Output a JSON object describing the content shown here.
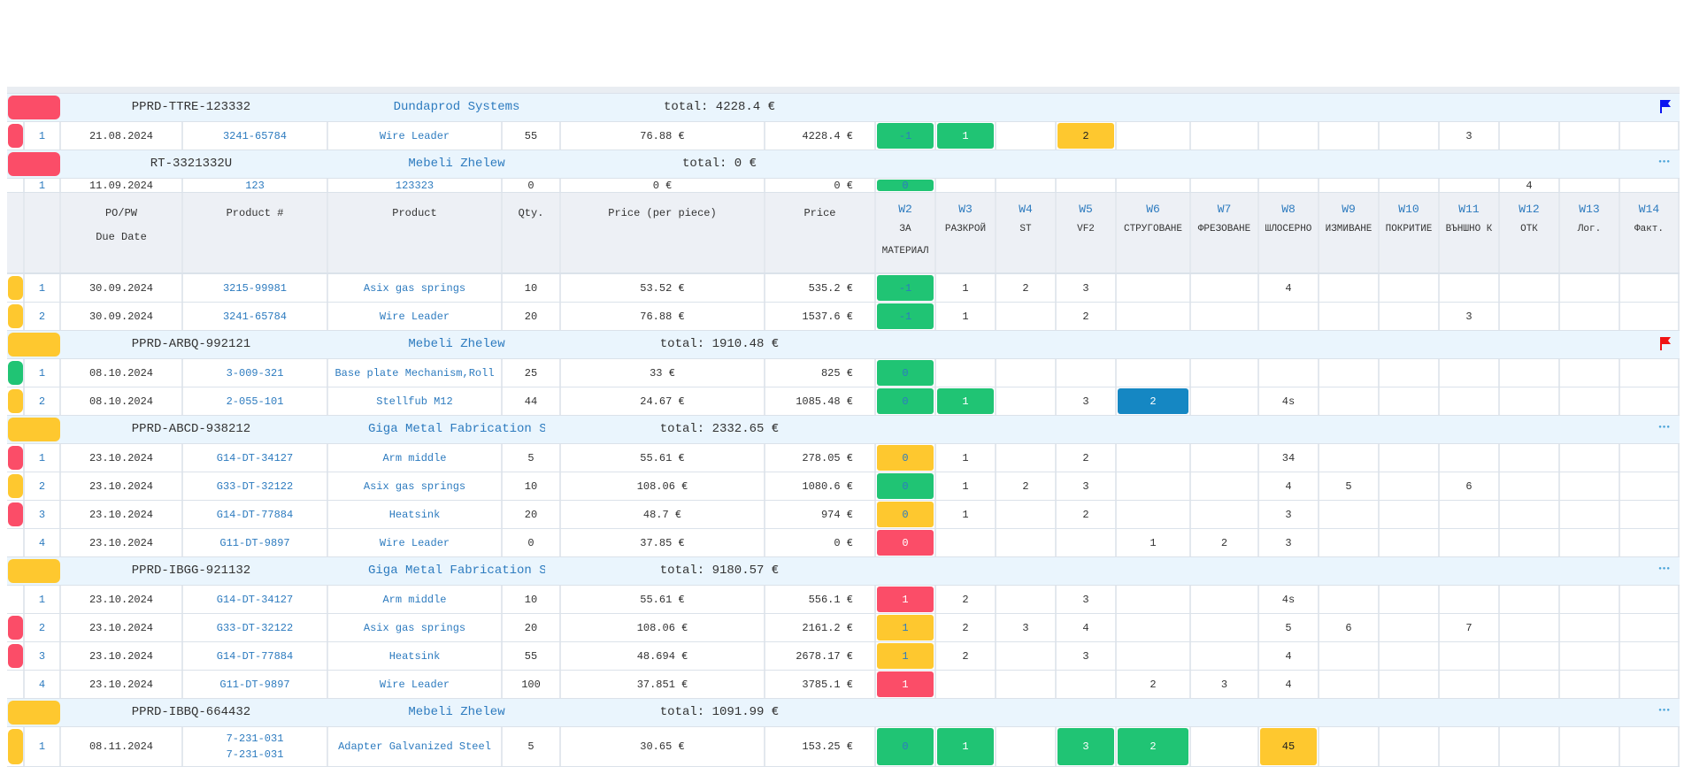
{
  "header": {
    "col_po": "PO/PW",
    "col_due": "Due Date",
    "col_product_no": "Product #",
    "col_product": "Product",
    "col_qty": "Qty.",
    "col_price_piece": "Price (per piece)",
    "col_price": "Price",
    "workstations": [
      {
        "code": "W2",
        "name": "ЗА",
        "name2": "МАТЕРИАЛ"
      },
      {
        "code": "W3",
        "name": "РАЗКРОЙ"
      },
      {
        "code": "W4",
        "name": "ST"
      },
      {
        "code": "W5",
        "name": "VF2"
      },
      {
        "code": "W6",
        "name": "СТРУГОВАНЕ"
      },
      {
        "code": "W7",
        "name": "ФРЕЗОВАНЕ"
      },
      {
        "code": "W8",
        "name": "ШЛОСЕРНО"
      },
      {
        "code": "W9",
        "name": "ИЗМИВАНЕ"
      },
      {
        "code": "W10",
        "name": "ПОКРИТИЕ"
      },
      {
        "code": "W11",
        "name": "ВЪНШНО К"
      },
      {
        "code": "W12",
        "name": "ОТК"
      },
      {
        "code": "W13",
        "name": "Лог."
      },
      {
        "code": "W14",
        "name": "Факт."
      }
    ]
  },
  "colors": {
    "green": "#20c474",
    "yellow": "#fec82f",
    "red": "#fb4d68",
    "blue": "#1587c3",
    "link": "#2d7bbf",
    "group_bg": "#eaf5fd"
  },
  "groups": [
    {
      "po": "PPRD-TTRE-123332",
      "client": "Dundaprod Systems",
      "total": "total: 4228.4 €",
      "status": "red",
      "icon": "flag-blue",
      "items": [
        {
          "n": "1",
          "date": "21.08.2024",
          "pn": "3241-65784",
          "product": "Wire Leader",
          "qty": "55",
          "ppp": "76.88 €",
          "price": "4228.4 €",
          "status": "red",
          "w": [
            {
              "v": "-1",
              "c": "green",
              "blue": true
            },
            {
              "v": "1",
              "c": "green"
            },
            {
              "v": ""
            },
            {
              "v": "2",
              "c": "yellow"
            },
            {
              "v": ""
            },
            {
              "v": ""
            },
            {
              "v": ""
            },
            {
              "v": ""
            },
            {
              "v": ""
            },
            {
              "v": "3"
            },
            {
              "v": ""
            },
            {
              "v": ""
            },
            {
              "v": ""
            }
          ]
        }
      ]
    },
    {
      "po": "RT-3321332U",
      "client": "Mebeli Zhelew",
      "total": "total: 0 €",
      "status": "red",
      "icon": "dots",
      "items": [
        {
          "n": "1",
          "date": "11.09.2024",
          "pn": "123",
          "product": "123323",
          "qty": "0",
          "ppp": "0 €",
          "price": "0 €",
          "status": "",
          "w": [
            {
              "v": "0",
              "c": "green",
              "blue": true
            },
            {
              "v": ""
            },
            {
              "v": ""
            },
            {
              "v": ""
            },
            {
              "v": ""
            },
            {
              "v": ""
            },
            {
              "v": ""
            },
            {
              "v": ""
            },
            {
              "v": ""
            },
            {
              "v": ""
            },
            {
              "v": "4"
            },
            {
              "v": ""
            },
            {
              "v": ""
            }
          ]
        },
        {
          "n": "1",
          "date": "30.09.2024",
          "pn": "3215-99981",
          "product": "Asix gas springs",
          "qty": "10",
          "ppp": "53.52 €",
          "price": "535.2 €",
          "status": "yellow",
          "w": [
            {
              "v": "-1",
              "c": "green",
              "blue": true
            },
            {
              "v": "1"
            },
            {
              "v": "2"
            },
            {
              "v": "3"
            },
            {
              "v": ""
            },
            {
              "v": ""
            },
            {
              "v": "4"
            },
            {
              "v": ""
            },
            {
              "v": ""
            },
            {
              "v": ""
            },
            {
              "v": ""
            },
            {
              "v": ""
            },
            {
              "v": ""
            }
          ]
        },
        {
          "n": "2",
          "date": "30.09.2024",
          "pn": "3241-65784",
          "product": "Wire Leader",
          "qty": "20",
          "ppp": "76.88 €",
          "price": "1537.6 €",
          "status": "yellow",
          "w": [
            {
              "v": "-1",
              "c": "green",
              "blue": true
            },
            {
              "v": "1"
            },
            {
              "v": ""
            },
            {
              "v": "2"
            },
            {
              "v": ""
            },
            {
              "v": ""
            },
            {
              "v": ""
            },
            {
              "v": ""
            },
            {
              "v": ""
            },
            {
              "v": "3"
            },
            {
              "v": ""
            },
            {
              "v": ""
            },
            {
              "v": ""
            }
          ]
        }
      ]
    },
    {
      "po": "PPRD-ARBQ-992121",
      "client": "Mebeli Zhelew",
      "total": "total: 1910.48 €",
      "status": "yellow",
      "icon": "flag-red",
      "items": [
        {
          "n": "1",
          "date": "08.10.2024",
          "pn": "3-009-321",
          "product": "Base plate Mechanism,Roll",
          "qty": "25",
          "ppp": "33 €",
          "price": "825 €",
          "status": "green",
          "w": [
            {
              "v": "0",
              "c": "green",
              "blue": true
            },
            {
              "v": ""
            },
            {
              "v": ""
            },
            {
              "v": ""
            },
            {
              "v": ""
            },
            {
              "v": ""
            },
            {
              "v": ""
            },
            {
              "v": ""
            },
            {
              "v": ""
            },
            {
              "v": ""
            },
            {
              "v": ""
            },
            {
              "v": ""
            },
            {
              "v": ""
            }
          ]
        },
        {
          "n": "2",
          "date": "08.10.2024",
          "pn": "2-055-101",
          "product": "Stellfub M12",
          "qty": "44",
          "ppp": "24.67 €",
          "price": "1085.48 €",
          "status": "yellow",
          "w": [
            {
              "v": "0",
              "c": "green",
              "blue": true
            },
            {
              "v": "1",
              "c": "green"
            },
            {
              "v": ""
            },
            {
              "v": "3"
            },
            {
              "v": "2",
              "c": "blue"
            },
            {
              "v": ""
            },
            {
              "v": "4s"
            },
            {
              "v": ""
            },
            {
              "v": ""
            },
            {
              "v": ""
            },
            {
              "v": ""
            },
            {
              "v": ""
            },
            {
              "v": ""
            }
          ]
        }
      ]
    },
    {
      "po": "PPRD-ABCD-938212",
      "client": "Giga Metal Fabrication Systems",
      "total": "total: 2332.65 €",
      "status": "yellow",
      "icon": "dots",
      "items": [
        {
          "n": "1",
          "date": "23.10.2024",
          "pn": "G14-DT-34127",
          "product": "Arm middle",
          "qty": "5",
          "ppp": "55.61 €",
          "price": "278.05 €",
          "status": "red",
          "w": [
            {
              "v": "0",
              "c": "yellow",
              "blue": true
            },
            {
              "v": "1"
            },
            {
              "v": ""
            },
            {
              "v": "2"
            },
            {
              "v": ""
            },
            {
              "v": ""
            },
            {
              "v": "34"
            },
            {
              "v": ""
            },
            {
              "v": ""
            },
            {
              "v": ""
            },
            {
              "v": ""
            },
            {
              "v": ""
            },
            {
              "v": ""
            }
          ]
        },
        {
          "n": "2",
          "date": "23.10.2024",
          "pn": "G33-DT-32122",
          "product": "Asix gas springs",
          "qty": "10",
          "ppp": "108.06 €",
          "price": "1080.6 €",
          "status": "yellow",
          "w": [
            {
              "v": "0",
              "c": "green",
              "blue": true
            },
            {
              "v": "1"
            },
            {
              "v": "2"
            },
            {
              "v": "3"
            },
            {
              "v": ""
            },
            {
              "v": ""
            },
            {
              "v": "4"
            },
            {
              "v": "5"
            },
            {
              "v": ""
            },
            {
              "v": "6"
            },
            {
              "v": ""
            },
            {
              "v": ""
            },
            {
              "v": ""
            }
          ]
        },
        {
          "n": "3",
          "date": "23.10.2024",
          "pn": "G14-DT-77884",
          "product": "Heatsink",
          "qty": "20",
          "ppp": "48.7 €",
          "price": "974 €",
          "status": "red",
          "w": [
            {
              "v": "0",
              "c": "yellow",
              "blue": true
            },
            {
              "v": "1"
            },
            {
              "v": ""
            },
            {
              "v": "2"
            },
            {
              "v": ""
            },
            {
              "v": ""
            },
            {
              "v": "3"
            },
            {
              "v": ""
            },
            {
              "v": ""
            },
            {
              "v": ""
            },
            {
              "v": ""
            },
            {
              "v": ""
            },
            {
              "v": ""
            }
          ]
        },
        {
          "n": "4",
          "date": "23.10.2024",
          "pn": "G11-DT-9897",
          "product": "Wire Leader",
          "qty": "0",
          "ppp": "37.85 €",
          "price": "0 €",
          "status": "",
          "w": [
            {
              "v": "0",
              "c": "red"
            },
            {
              "v": ""
            },
            {
              "v": ""
            },
            {
              "v": ""
            },
            {
              "v": "1"
            },
            {
              "v": "2"
            },
            {
              "v": "3"
            },
            {
              "v": ""
            },
            {
              "v": ""
            },
            {
              "v": ""
            },
            {
              "v": ""
            },
            {
              "v": ""
            },
            {
              "v": ""
            }
          ]
        }
      ]
    },
    {
      "po": "PPRD-IBGG-921132",
      "client": "Giga Metal Fabrication Systems",
      "total": "total: 9180.57 €",
      "status": "yellow",
      "icon": "dots",
      "items": [
        {
          "n": "1",
          "date": "23.10.2024",
          "pn": "G14-DT-34127",
          "product": "Arm middle",
          "qty": "10",
          "ppp": "55.61 €",
          "price": "556.1 €",
          "status": "",
          "w": [
            {
              "v": "1",
              "c": "red"
            },
            {
              "v": "2"
            },
            {
              "v": ""
            },
            {
              "v": "3"
            },
            {
              "v": ""
            },
            {
              "v": ""
            },
            {
              "v": "4s"
            },
            {
              "v": ""
            },
            {
              "v": ""
            },
            {
              "v": ""
            },
            {
              "v": ""
            },
            {
              "v": ""
            },
            {
              "v": ""
            }
          ]
        },
        {
          "n": "2",
          "date": "23.10.2024",
          "pn": "G33-DT-32122",
          "product": "Asix gas springs",
          "qty": "20",
          "ppp": "108.06 €",
          "price": "2161.2 €",
          "status": "red",
          "w": [
            {
              "v": "1",
              "c": "yellow",
              "blue": true
            },
            {
              "v": "2"
            },
            {
              "v": "3"
            },
            {
              "v": "4"
            },
            {
              "v": ""
            },
            {
              "v": ""
            },
            {
              "v": "5"
            },
            {
              "v": "6"
            },
            {
              "v": ""
            },
            {
              "v": "7"
            },
            {
              "v": ""
            },
            {
              "v": ""
            },
            {
              "v": ""
            }
          ]
        },
        {
          "n": "3",
          "date": "23.10.2024",
          "pn": "G14-DT-77884",
          "product": "Heatsink",
          "qty": "55",
          "ppp": "48.694 €",
          "price": "2678.17 €",
          "status": "red",
          "w": [
            {
              "v": "1",
              "c": "yellow",
              "blue": true
            },
            {
              "v": "2"
            },
            {
              "v": ""
            },
            {
              "v": "3"
            },
            {
              "v": ""
            },
            {
              "v": ""
            },
            {
              "v": "4"
            },
            {
              "v": ""
            },
            {
              "v": ""
            },
            {
              "v": ""
            },
            {
              "v": ""
            },
            {
              "v": ""
            },
            {
              "v": ""
            }
          ]
        },
        {
          "n": "4",
          "date": "23.10.2024",
          "pn": "G11-DT-9897",
          "product": "Wire Leader",
          "qty": "100",
          "ppp": "37.851 €",
          "price": "3785.1 €",
          "status": "",
          "w": [
            {
              "v": "1",
              "c": "red"
            },
            {
              "v": ""
            },
            {
              "v": ""
            },
            {
              "v": ""
            },
            {
              "v": "2"
            },
            {
              "v": "3"
            },
            {
              "v": "4"
            },
            {
              "v": ""
            },
            {
              "v": ""
            },
            {
              "v": ""
            },
            {
              "v": ""
            },
            {
              "v": ""
            },
            {
              "v": ""
            }
          ]
        }
      ]
    },
    {
      "po": "PPRD-IBBQ-664432",
      "client": "Mebeli Zhelew",
      "total": "total: 1091.99 €",
      "status": "yellow",
      "icon": "dots",
      "items": [
        {
          "n": "1",
          "date": "08.11.2024",
          "pn": "7-231-031",
          "pn2": "7-231-031",
          "product": "Adapter Galvanized Steel",
          "qty": "5",
          "ppp": "30.65 €",
          "price": "153.25 €",
          "status": "yellow",
          "w": [
            {
              "v": "0",
              "c": "green",
              "blue": true
            },
            {
              "v": "1",
              "c": "green"
            },
            {
              "v": ""
            },
            {
              "v": "3",
              "c": "green"
            },
            {
              "v": "2",
              "c": "green"
            },
            {
              "v": ""
            },
            {
              "v": "45",
              "c": "yellow"
            },
            {
              "v": ""
            },
            {
              "v": ""
            },
            {
              "v": ""
            },
            {
              "v": ""
            },
            {
              "v": ""
            },
            {
              "v": ""
            }
          ]
        }
      ]
    }
  ]
}
